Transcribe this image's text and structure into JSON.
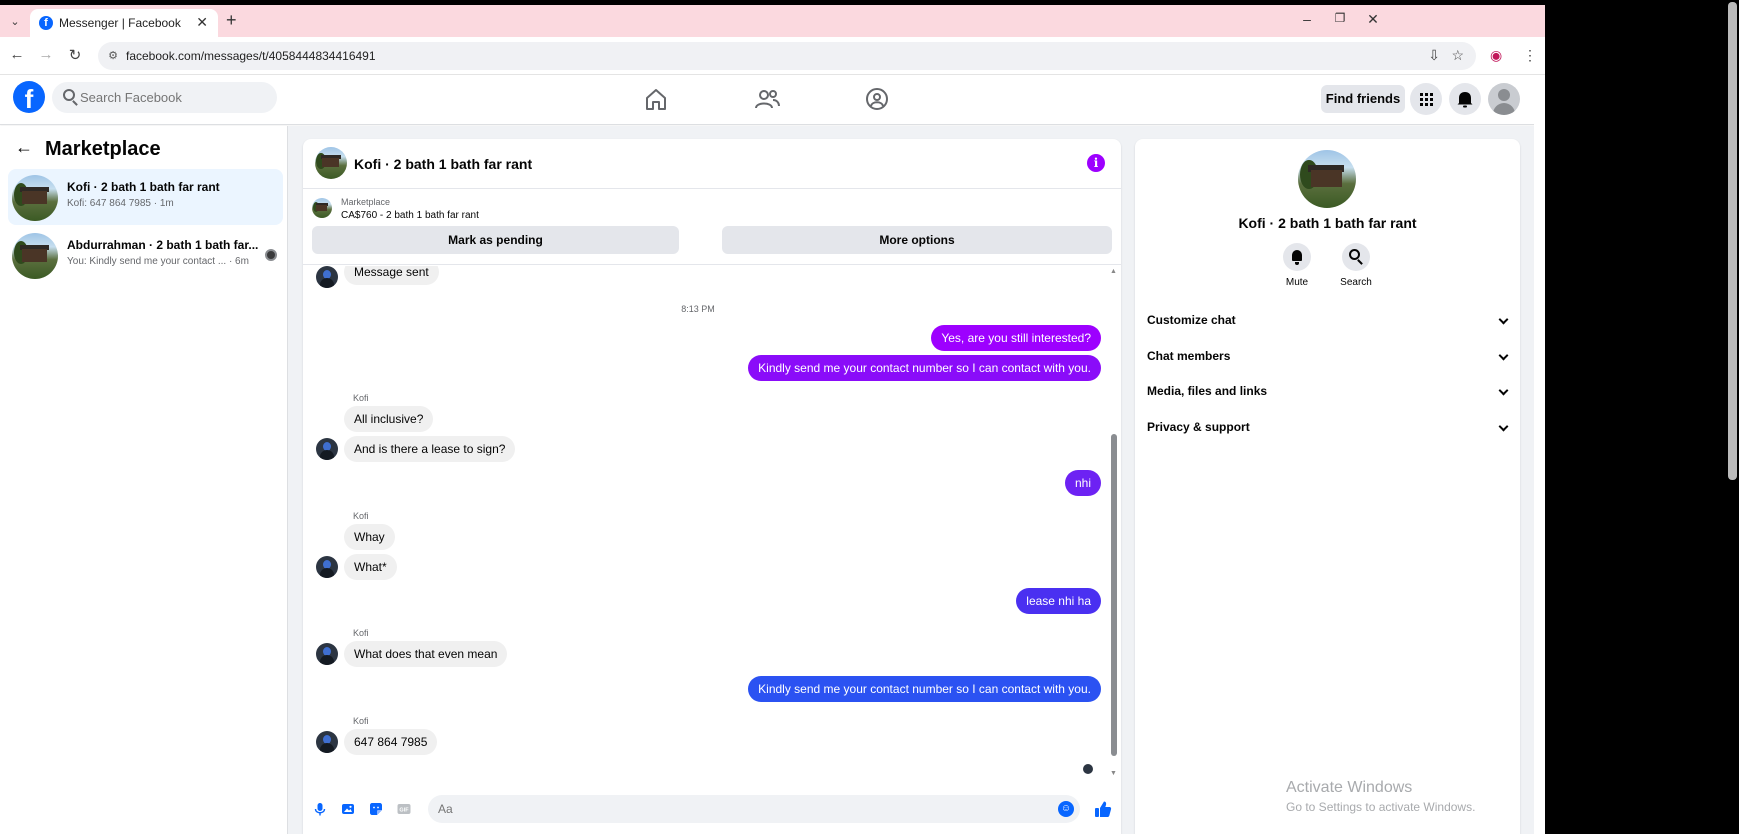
{
  "browser": {
    "tab_title": "Messenger | Facebook",
    "url": "facebook.com/messages/t/4058444834416491"
  },
  "header": {
    "search_placeholder": "Search Facebook",
    "find_friends": "Find friends"
  },
  "sidebar": {
    "title": "Marketplace",
    "conversations": [
      {
        "name": "Kofi · 2 bath 1 bath far rant",
        "preview": "Kofi: 647 864 7985 · 1m",
        "active": true
      },
      {
        "name": "Abdurrahman · 2 bath 1 bath far...",
        "preview": "You: Kindly send me your contact ... · 6m",
        "active": false
      }
    ]
  },
  "chat": {
    "title": "Kofi · 2 bath 1 bath far rant",
    "listing_label": "Marketplace",
    "listing_price": "CA$760 - 2 bath 1 bath far rant",
    "mark_pending": "Mark as pending",
    "more_options": "More options",
    "messages": {
      "m0": "Message sent",
      "time": "8:13 PM",
      "m1": "Yes, are you still interested?",
      "m2": "Kindly send me your contact number so I can contact with you.",
      "sender": "Kofi",
      "m3": "All inclusive?",
      "m4": "And is there a lease to sign?",
      "m5": "nhi",
      "m6": "Whay",
      "m7": "What*",
      "m8": "lease nhi ha",
      "m9": "What does that even mean",
      "m10": "Kindly send me your contact number so I can contact with you.",
      "m11": "647 864 7985"
    },
    "composer_placeholder": "Aa"
  },
  "info_panel": {
    "name": "Kofi · 2 bath 1 bath far rant",
    "mute": "Mute",
    "search": "Search",
    "sections": [
      "Customize chat",
      "Chat members",
      "Media, files and links",
      "Privacy & support"
    ]
  },
  "watermark": {
    "line1": "Activate Windows",
    "line2": "Go to Settings to activate Windows."
  },
  "colors": {
    "fb_blue": "#0866ff",
    "bubble_purple": "#9d00ff",
    "bubble_violet": "#7c1cf5",
    "bubble_indigo": "#5b28f0",
    "bubble_blue": "#2b52f2",
    "tab_strip": "#fbd9df"
  }
}
